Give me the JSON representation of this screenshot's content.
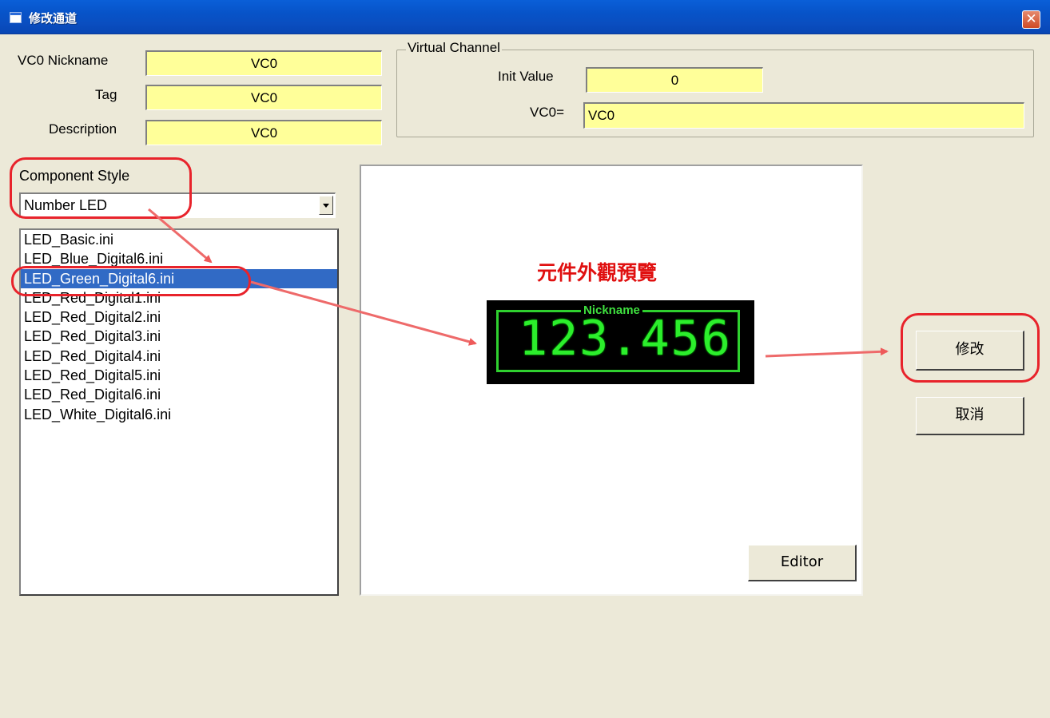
{
  "window": {
    "title": "修改通道"
  },
  "fields": {
    "nickname": {
      "label": "VC0 Nickname",
      "value": "VC0"
    },
    "tag": {
      "label": "Tag",
      "value": "VC0"
    },
    "description": {
      "label": "Description",
      "value": "VC0"
    }
  },
  "virtual_channel": {
    "group_title": "Virtual Channel",
    "init_value_label": "Init Value",
    "init_value": "0",
    "expr_label": "VC0=",
    "expr_value": "VC0"
  },
  "component_style": {
    "label": "Component Style",
    "selected": "Number LED",
    "files": [
      "LED_Basic.ini",
      "LED_Blue_Digital6.ini",
      "LED_Green_Digital6.ini",
      "LED_Red_Digital1.ini",
      "LED_Red_Digital2.ini",
      "LED_Red_Digital3.ini",
      "LED_Red_Digital4.ini",
      "LED_Red_Digital5.ini",
      "LED_Red_Digital6.ini",
      "LED_White_Digital6.ini"
    ],
    "selected_index": 2
  },
  "preview": {
    "caption": "元件外觀預覽",
    "led_nickname": "Nickname",
    "led_value": "123.456",
    "led_color": "#2cee2c"
  },
  "buttons": {
    "editor": "Editor",
    "modify": "修改",
    "cancel": "取消"
  },
  "annotation_color": "#e8232b"
}
